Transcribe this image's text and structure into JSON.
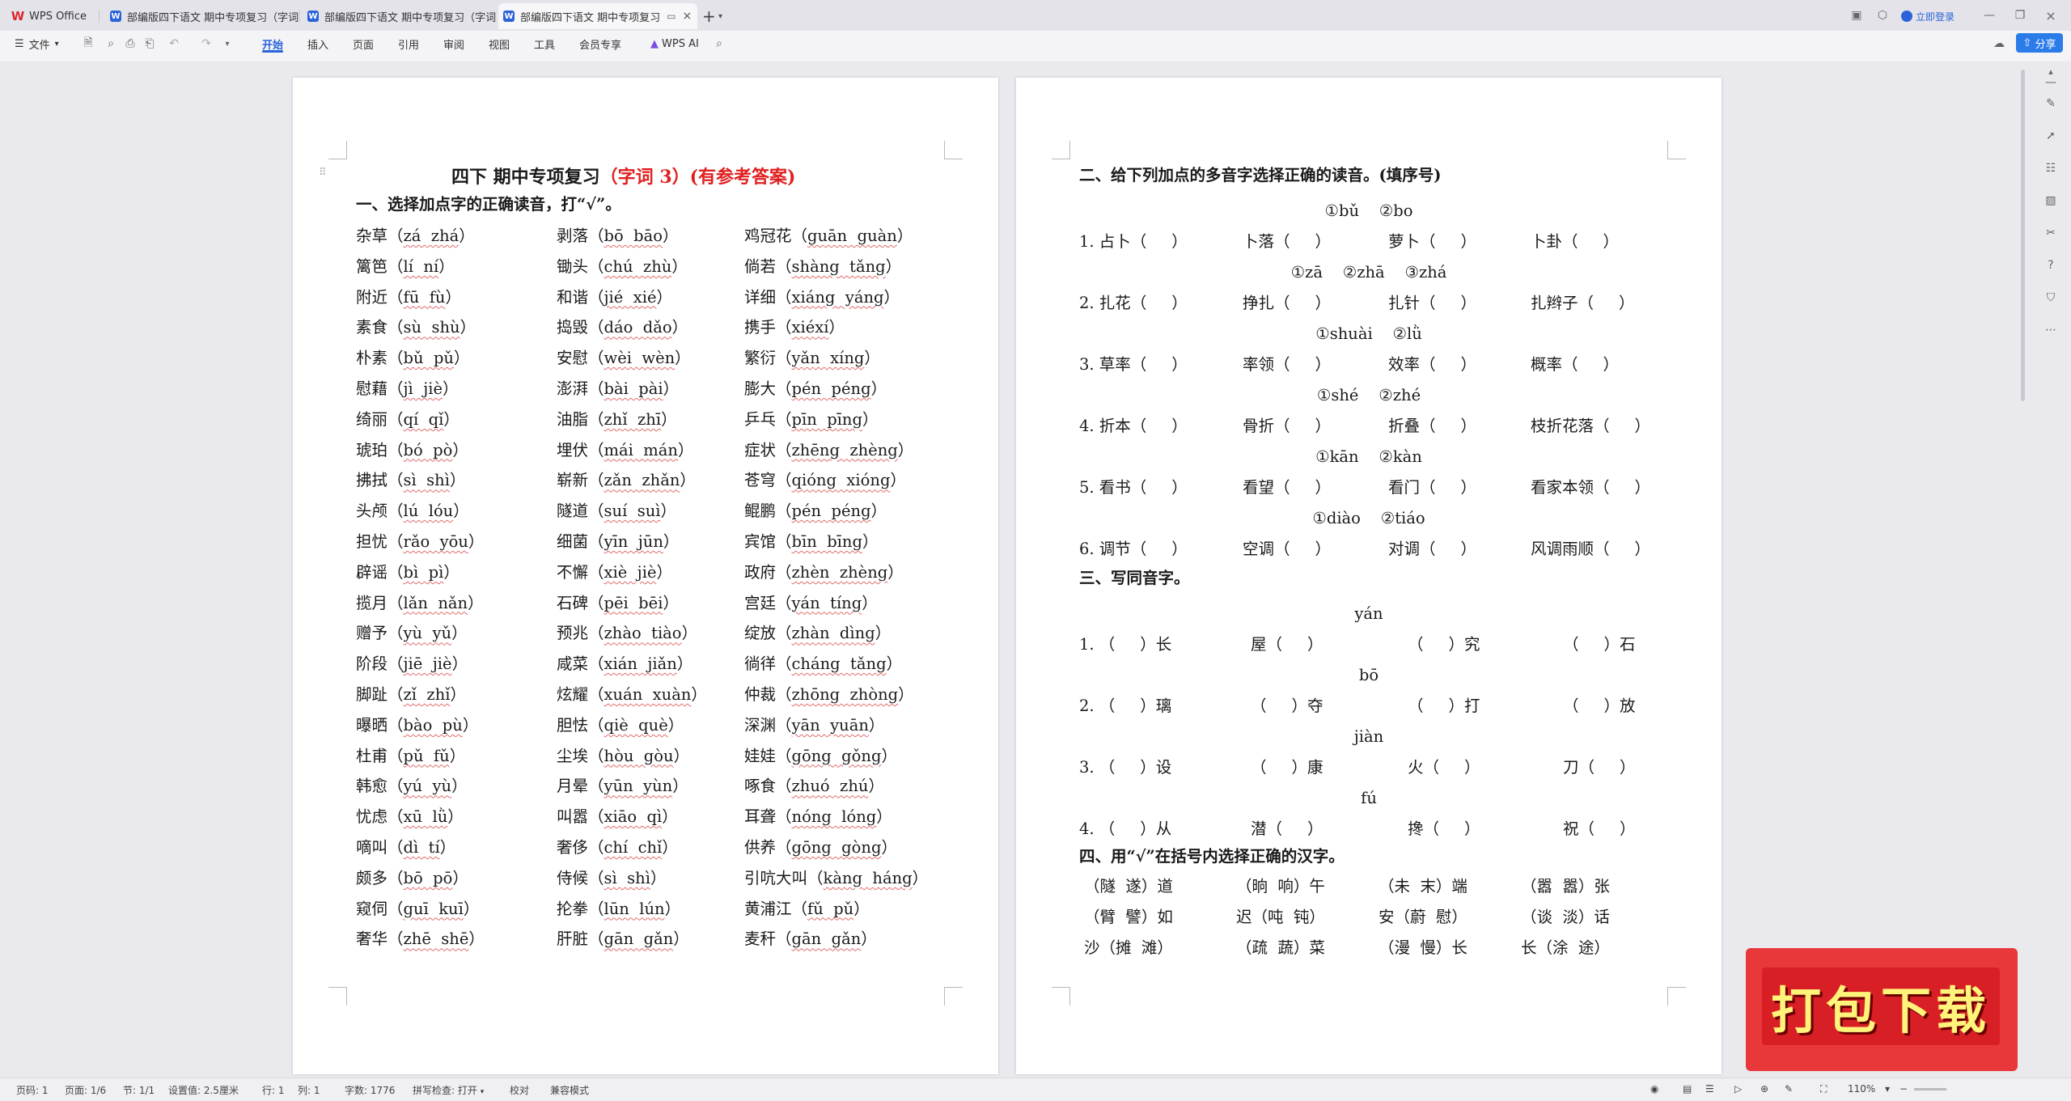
{
  "titlebar": {
    "app_tab": "WPS Office",
    "tabs": [
      "部编版四下语文 期中专项复习（字词",
      "部编版四下语文 期中专项复习（字词",
      "部编版四下语文 期中专项复习"
    ],
    "new_tab": "+",
    "login": "立即登录"
  },
  "menubar": {
    "file": "文件",
    "tabs": [
      "开始",
      "插入",
      "页面",
      "引用",
      "审阅",
      "视图",
      "工具",
      "会员专享"
    ],
    "wps_ai": "WPS AI",
    "share": "分享"
  },
  "page1": {
    "title_black": "四下 期中专项复习",
    "title_red": "（字词 3）(有参考答案)",
    "section1": "一、选择加点字的正确读音，打“√”。",
    "rows": [
      [
        [
          "杂草（",
          "zá  zhá",
          "）"
        ],
        [
          "剥落（",
          "bō  bāo",
          "）"
        ],
        [
          "鸡冠花（",
          "guān  guàn",
          "）"
        ]
      ],
      [
        [
          "篱笆（",
          "lí  ní",
          "）"
        ],
        [
          "锄头（",
          "chú  zhù",
          "）"
        ],
        [
          "倘若（",
          "shàng  tǎng",
          "）"
        ]
      ],
      [
        [
          "附近（",
          "fū  fù",
          "）"
        ],
        [
          "和谐（",
          "jié  xié",
          "）"
        ],
        [
          "详细（",
          "xiáng  yáng",
          "）"
        ]
      ],
      [
        [
          "素食（",
          "sù  shù",
          "）"
        ],
        [
          "捣毁（",
          "dáo  dǎo",
          "）"
        ],
        [
          "携手（",
          "xiéxí",
          "）"
        ]
      ],
      [
        [
          "朴素（",
          "bǔ  pǔ",
          "）"
        ],
        [
          "安慰（",
          "wèi  wèn",
          "）"
        ],
        [
          "繁衍（",
          "yǎn  xíng",
          "）"
        ]
      ],
      [
        [
          "慰藉（",
          "jì  jiè",
          "）"
        ],
        [
          "澎湃（",
          "bài  pài",
          "）"
        ],
        [
          "膨大（",
          "pén  péng",
          "）"
        ]
      ],
      [
        [
          "绮丽（",
          "qí  qǐ",
          "）"
        ],
        [
          "油脂（",
          "zhǐ  zhī",
          "）"
        ],
        [
          "乒乓（",
          "pīn  pīng",
          "）"
        ]
      ],
      [
        [
          "琥珀（",
          "bó  pò",
          "）"
        ],
        [
          "埋伏（",
          "mái  mán",
          "）"
        ],
        [
          "症状（",
          "zhēng  zhèng",
          "）"
        ]
      ],
      [
        [
          "拂拭（",
          "sì  shì",
          "）"
        ],
        [
          "崭新（",
          "zǎn  zhǎn",
          "）"
        ],
        [
          "苍穹（",
          "qióng  xióng",
          "）"
        ]
      ],
      [
        [
          "头颅（",
          "lú  lóu",
          "）"
        ],
        [
          "隧道（",
          "suí  suì",
          "）"
        ],
        [
          "鲲鹏（",
          "pén  péng",
          "）"
        ]
      ],
      [
        [
          "担忧（",
          "rǎo  yōu",
          "）"
        ],
        [
          "细菌（",
          "yīn  jūn",
          "）"
        ],
        [
          "宾馆（",
          "bīn  bīng",
          "）"
        ]
      ],
      [
        [
          "辟谣（",
          "bì  pì",
          "）"
        ],
        [
          "不懈（",
          "xiè  jiè",
          "）"
        ],
        [
          "政府（",
          "zhèn  zhèng",
          "）"
        ]
      ],
      [
        [
          "揽月（",
          "lǎn  nǎn",
          "）"
        ],
        [
          "石碑（",
          "pēi  bēi",
          "）"
        ],
        [
          "宫廷（",
          "yán  tíng",
          "）"
        ]
      ],
      [
        [
          "赠予（",
          "yù  yǔ",
          "）"
        ],
        [
          "预兆（",
          "zhào  tiào",
          "）"
        ],
        [
          "绽放（",
          "zhàn  dìng",
          "）"
        ]
      ],
      [
        [
          "阶段（",
          "jiē  jiè",
          "）"
        ],
        [
          "咸菜（",
          "xián  jiǎn",
          "）"
        ],
        [
          "徜徉（",
          "cháng  tǎng",
          "）"
        ]
      ],
      [
        [
          "脚趾（",
          "zǐ  zhǐ",
          "）"
        ],
        [
          "炫耀（",
          "xuán  xuàn",
          "）"
        ],
        [
          "仲裁（",
          "zhōng  zhòng",
          "）"
        ]
      ],
      [
        [
          "曝晒（",
          "bào  pù",
          "）"
        ],
        [
          "胆怯（",
          "qiè  què",
          "）"
        ],
        [
          "深渊（",
          "yān  yuān",
          "）"
        ]
      ],
      [
        [
          "杜甫（",
          "pǔ  fǔ",
          "）"
        ],
        [
          "尘埃（",
          "hòu  gòu",
          "）"
        ],
        [
          "娃娃（",
          "gōng  gǒng",
          "）"
        ]
      ],
      [
        [
          "韩愈（",
          "yú  yù",
          "）"
        ],
        [
          "月晕（",
          "yūn  yùn",
          "）"
        ],
        [
          "啄食（",
          "zhuó  zhú",
          "）"
        ]
      ],
      [
        [
          "忧虑（",
          "xū  lǜ",
          "）"
        ],
        [
          "叫嚣（",
          "xiāo  qì",
          "）"
        ],
        [
          "耳聋（",
          "nóng  lóng",
          "）"
        ]
      ],
      [
        [
          "嘀叫（",
          "dì  tí",
          "）"
        ],
        [
          "奢侈（",
          "chí  chǐ",
          "）"
        ],
        [
          "供养（",
          "gōng  gòng",
          "）"
        ]
      ],
      [
        [
          "颇多（",
          "bō  pō",
          "）"
        ],
        [
          "侍候（",
          "sì  shì",
          "）"
        ],
        [
          "引吭大叫（",
          "kàng  háng",
          "）"
        ]
      ],
      [
        [
          "窥伺（",
          "guī  kuī",
          "）"
        ],
        [
          "抡拳（",
          "lūn  lún",
          "）"
        ],
        [
          "黄浦江（",
          "fǔ  pǔ",
          "）"
        ]
      ],
      [
        [
          "奢华（",
          "zhē  shē",
          "）"
        ],
        [
          "肝脏（",
          "gān  gǎn",
          "）"
        ],
        [
          "麦秆（",
          "gān  gǎn",
          "）"
        ]
      ]
    ]
  },
  "page2": {
    "section2": "二、给下列加点的多音字选择正确的读音。(填序号)",
    "groups": [
      {
        "options": "①bǔ    ②bo",
        "items": [
          "1. 占卜（     ）",
          "卜落（     ）",
          "萝卜（     ）",
          "卜卦（     ）"
        ]
      },
      {
        "options": "①zā    ②zhā    ③zhá",
        "items": [
          "2. 扎花（     ）",
          "挣扎（     ）",
          "扎针（     ）",
          "扎辫子（     ）"
        ]
      },
      {
        "options": "①shuài    ②lǜ",
        "items": [
          "3. 草率（     ）",
          "率领（     ）",
          "效率（     ）",
          "概率（     ）"
        ]
      },
      {
        "options": "①shé    ②zhé",
        "items": [
          "4. 折本（     ）",
          "骨折（     ）",
          "折叠（     ）",
          "枝折花落（     ）"
        ]
      },
      {
        "options": "①kān    ②kàn",
        "items": [
          "5. 看书（     ）",
          "看望（     ）",
          "看门（     ）",
          "看家本领（     ）"
        ]
      },
      {
        "options": "①diào    ②tiáo",
        "items": [
          "6. 调节（     ）",
          "空调（     ）",
          "对调（     ）",
          "风调雨顺（     ）"
        ]
      }
    ],
    "section3": "三、写同音字。",
    "homophones": [
      {
        "pinyin": "yán",
        "items": [
          "1. （     ）长",
          "屋（     ）",
          "（     ）究",
          "（     ）石"
        ]
      },
      {
        "pinyin": "bō",
        "items": [
          "2. （     ）璃",
          "（     ）夺",
          "（     ）打",
          "（     ）放"
        ]
      },
      {
        "pinyin": "jiàn",
        "items": [
          "3. （     ）设",
          "（     ）康",
          "火（     ）",
          "刀（     ）"
        ]
      },
      {
        "pinyin": "fú",
        "items": [
          "4. （     ）从",
          "潜（     ）",
          "搀（     ）",
          "祝（     ）"
        ]
      }
    ],
    "section4": "四、用“√”在括号内选择正确的汉字。",
    "choices": [
      [
        "（隧  遂）道",
        "（晌  响）午",
        "（未  末）端",
        "（嚣  嚣）张"
      ],
      [
        "（臂  譬）如",
        "迟（吨  钝）",
        "安（蔚  慰）",
        "（谈  淡）话"
      ],
      [
        "沙（摊  滩）",
        "（疏  蔬）菜",
        "（漫  慢）长",
        "长（涂  途）"
      ]
    ]
  },
  "statusbar": {
    "page": "页码: 1",
    "pages": "页面: 1/6",
    "section": "节: 1/1",
    "setting": "设置值: 2.5厘米",
    "row": "行: 1",
    "col": "列: 1",
    "words": "字数: 1776",
    "spell": "拼写检查: 打开",
    "proof": "校对",
    "compat": "兼容模式",
    "zoom": "110%"
  },
  "banner": {
    "text": "打包下载"
  }
}
